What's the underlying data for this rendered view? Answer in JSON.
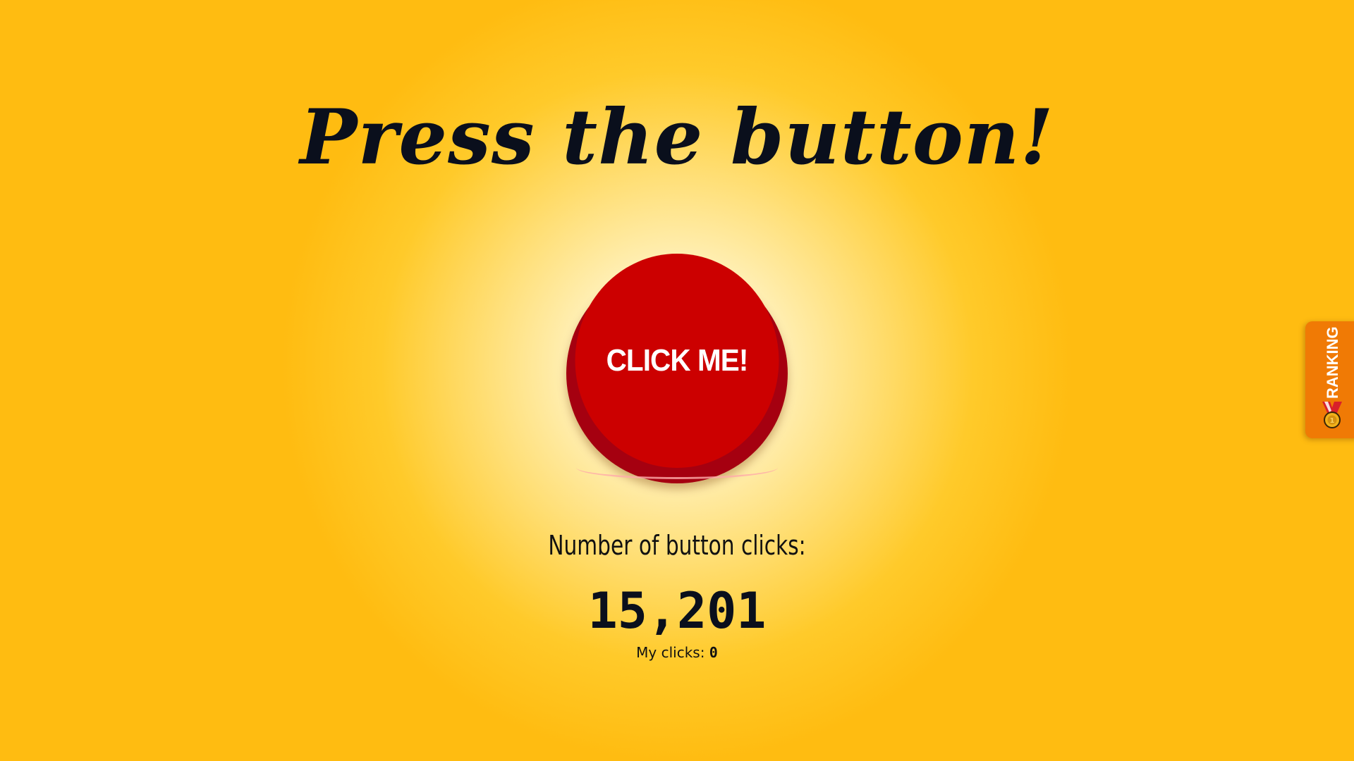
{
  "title": "Press the button!",
  "button": {
    "label": "CLICK ME!"
  },
  "stats": {
    "label": "Number of button clicks:",
    "total": "15,201",
    "my_clicks_label": "My clicks:",
    "my_clicks_value": "0"
  },
  "ranking_tab": {
    "label": "RANKING",
    "icon": "medal-icon"
  },
  "colors": {
    "background": "#ffbc11",
    "button_face": "#cc0000",
    "button_side": "#a50010",
    "ranking_tab": "#f07a05",
    "text_dark": "#0a0f1c"
  }
}
